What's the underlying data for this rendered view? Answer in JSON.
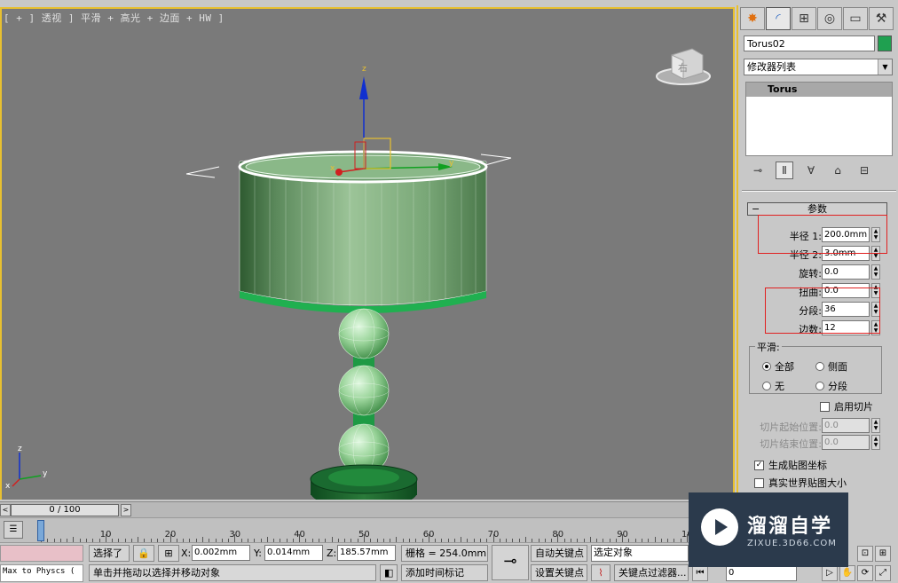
{
  "viewport": {
    "label": "[ + ] 透视 ] 平滑 + 高光 + 边面 + HW ]",
    "viewcube_face": "右",
    "gizmo_axes": {
      "x": "x",
      "y": "y",
      "z": "z"
    },
    "corner_axes": {
      "x": "x",
      "y": "y",
      "z": "z"
    }
  },
  "panel": {
    "tabs": [
      "create-icon",
      "modify-icon",
      "hierarchy-icon",
      "motion-icon",
      "display-icon",
      "utilities-icon"
    ],
    "object_name": "Torus02",
    "object_color": "#1fa050",
    "modifier_list": "修改器列表",
    "stack_item": "Torus",
    "rollout_title": "参数",
    "params": {
      "radius1_label": "半径 1:",
      "radius1": "200.0mm",
      "radius2_label": "半径 2:",
      "radius2": "3.0mm",
      "rotation_label": "旋转:",
      "rotation": "0.0",
      "twist_label": "扭曲:",
      "twist": "0.0",
      "segments_label": "分段:",
      "segments": "36",
      "sides_label": "边数:",
      "sides": "12"
    },
    "smooth": {
      "title": "平滑:",
      "all": "全部",
      "sides": "侧面",
      "none": "无",
      "segments": "分段",
      "selected": "all"
    },
    "slice_on": "启用切片",
    "slice_from_label": "切片起始位置:",
    "slice_from": "0.0",
    "slice_to_label": "切片结束位置:",
    "slice_to": "0.0",
    "gen_mapping": "生成贴图坐标",
    "gen_mapping_checked": true,
    "real_world": "真实世界贴图大小",
    "real_world_checked": false
  },
  "timeline": {
    "frame": "0 / 100",
    "ticks": [
      "0",
      "10",
      "20",
      "30",
      "40",
      "50",
      "60",
      "70",
      "80",
      "90",
      "10"
    ]
  },
  "status": {
    "maxscript": "Max to Physcs (",
    "selected": "选择了",
    "x_label": "X:",
    "x": "0.002mm",
    "y_label": "Y:",
    "y": "0.014mm",
    "z_label": "Z:",
    "z": "185.57mm",
    "grid": "栅格 = 254.0mm",
    "prompt": "单击并拖动以选择并移动对象",
    "add_time_tag": "添加时间标记",
    "auto_key": "自动关键点",
    "set_key": "设置关键点",
    "selection_set": "选定对象",
    "key_filters": "关键点过滤器...",
    "frame_field": "0"
  },
  "watermark": {
    "title": "溜溜自学",
    "subtitle": "ZIXUE.3D66.COM"
  }
}
